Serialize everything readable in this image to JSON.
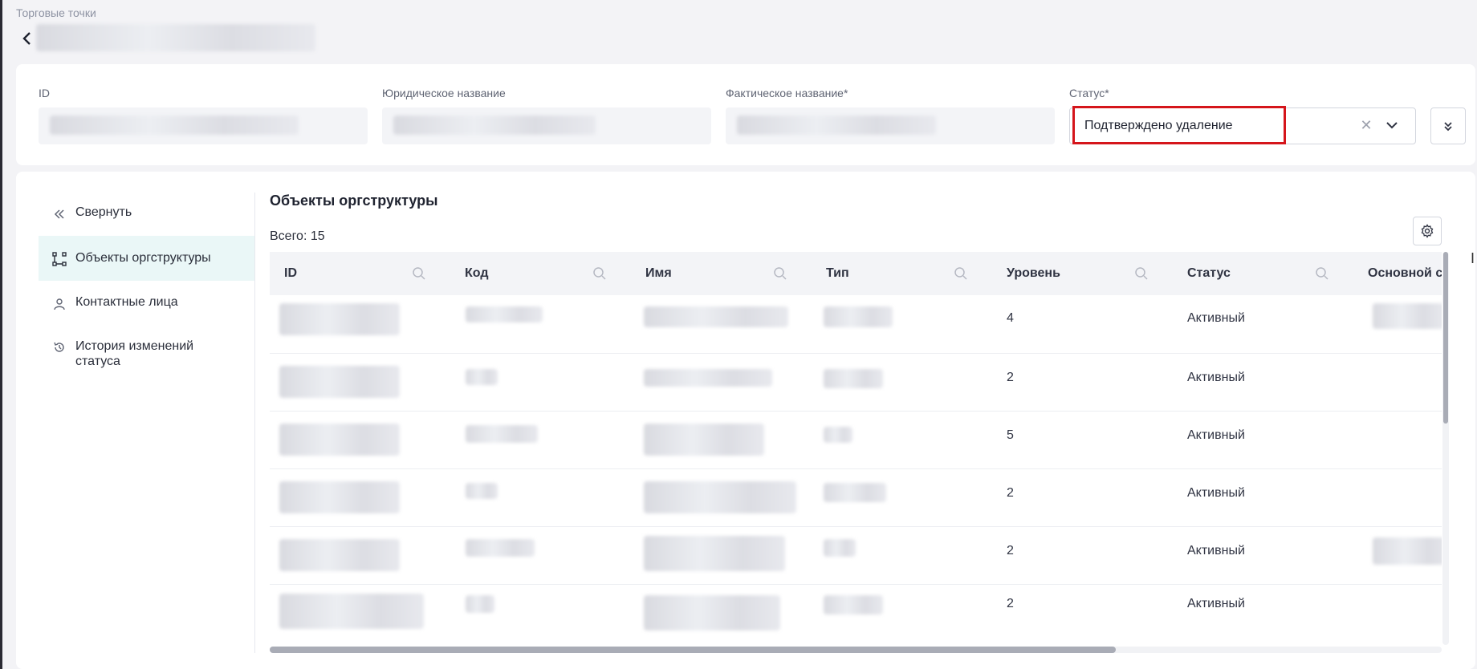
{
  "breadcrumb": "Торговые точки",
  "header": {
    "fields": [
      {
        "label": "ID"
      },
      {
        "label": "Юридическое название"
      },
      {
        "label": "Фактическое название*"
      }
    ],
    "status": {
      "label": "Статус*",
      "value": "Подтверждено удаление"
    }
  },
  "sidebar": {
    "collapse_label": "Свернуть",
    "items": [
      {
        "label": "Объекты оргструктуры",
        "icon": "org-structure-icon",
        "active": true
      },
      {
        "label": "Контактные лица",
        "icon": "person-icon",
        "active": false
      },
      {
        "label": "История изменений статуса",
        "icon": "history-icon",
        "active": false
      }
    ]
  },
  "main": {
    "title": "Объекты оргструктуры",
    "total": "Всего: 15",
    "columns": [
      "ID",
      "Код",
      "Имя",
      "Тип",
      "Уровень",
      "Статус",
      "Основной со"
    ],
    "rows": [
      {
        "level": "4",
        "status": "Активный"
      },
      {
        "level": "2",
        "status": "Активный"
      },
      {
        "level": "5",
        "status": "Активный"
      },
      {
        "level": "2",
        "status": "Активный"
      },
      {
        "level": "2",
        "status": "Активный"
      },
      {
        "level": "2",
        "status": "Активный"
      }
    ]
  },
  "colors": {
    "accent": "#eaf7f7",
    "highlight": "#d5151b"
  }
}
